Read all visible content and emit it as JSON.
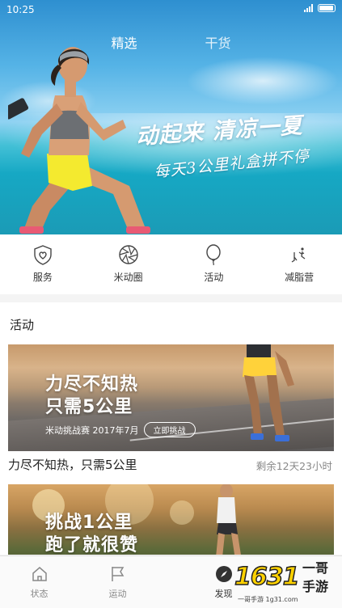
{
  "status_bar": {
    "time": "10:25"
  },
  "top_tabs": [
    {
      "label": "精选"
    },
    {
      "label": "干货"
    }
  ],
  "banner": {
    "slogan": "动起来 清凉一夏",
    "subtitle": "每天3公里礼盒拼不停"
  },
  "quick_entries": [
    {
      "label": "服务",
      "icon": "shield-heart-icon"
    },
    {
      "label": "米动圈",
      "icon": "aperture-icon"
    },
    {
      "label": "活动",
      "icon": "balloon-icon"
    },
    {
      "label": "减脂营",
      "icon": "fitness-icon"
    }
  ],
  "activity_section": {
    "title": "活动",
    "cards": [
      {
        "image_title_line1": "力尽不知热",
        "image_title_line2": "只需5公里",
        "meta": "米动挑战赛 2017年7月",
        "button": "立即挑战",
        "caption": "力尽不知热，只需5公里",
        "remaining": "剩余12天23小时"
      },
      {
        "image_title_line1": "挑战1公里",
        "image_title_line2": "跑了就很赞"
      }
    ]
  },
  "bottom_nav": [
    {
      "label": "状态",
      "icon": "home-icon"
    },
    {
      "label": "运动",
      "icon": "flag-icon"
    },
    {
      "label": "发现",
      "icon": "compass-icon",
      "active": true
    }
  ],
  "watermark": {
    "logo": "1631",
    "name_line1": "一哥",
    "name_line2": "手游",
    "url": "一哥手游 1g31.com"
  }
}
